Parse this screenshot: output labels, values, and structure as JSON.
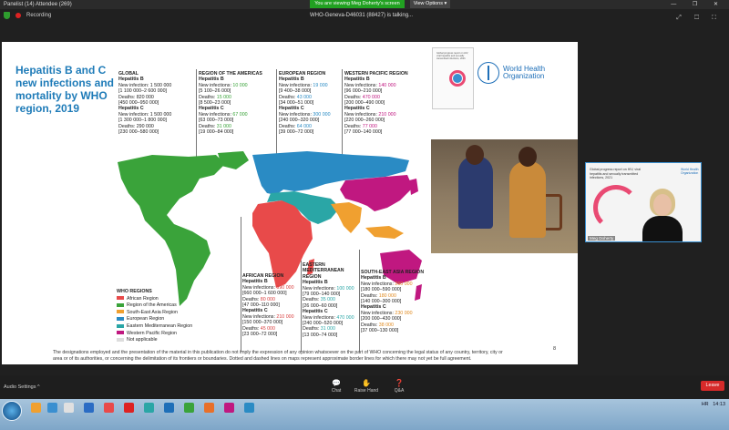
{
  "window": {
    "title": "Panelist (14) Attendee (269)",
    "banner": "You are viewing Meg Doherty's screen",
    "view_options": "View Options",
    "view_options_chevron": "▾",
    "recording": "Recording",
    "talking": "WHO-Geneva-D46031 (88427) is talking...",
    "window_buttons": "— ❐ ✕"
  },
  "slide": {
    "title": "Hepatitis B and C new infections and mortality by WHO region, 2019",
    "regions": [
      {
        "name": "GLOBAL",
        "hepb_label": "Hepatitis B",
        "hepb_new": "New infection: 1 500 000",
        "hepb_new_ci": "[1 100 000–2 600 000]",
        "hepb_deaths": "Deaths: 820 000",
        "hepb_deaths_ci": "[450 000–950 000]",
        "hepc_label": "Hepatitis C",
        "hepc_new": "New infection: 1 500 000",
        "hepc_new_ci": "[1 300 000–1 800 000]",
        "hepc_deaths": "Deaths: 290 000",
        "hepc_deaths_ci": "[230 000–580 000]"
      },
      {
        "name": "REGION OF THE AMERICAS",
        "hepb_label": "Hepatitis B",
        "hepb_new_label": "New infections:",
        "hepb_new_val": "10 000",
        "hepb_new_ci": "[5 100–26 000]",
        "hepb_deaths_label": "Deaths:",
        "hepb_deaths_val": "15 000",
        "hepb_deaths_ci": "[8 500–23 000]",
        "hepc_label": "Hepatitis C",
        "hepc_new_label": "New infections:",
        "hepc_new_val": "67 000",
        "hepc_new_ci": "[63 000–73 000]",
        "hepc_deaths_label": "Deaths:",
        "hepc_deaths_val": "31 000",
        "hepc_deaths_ci": "[19 000–84 000]"
      },
      {
        "name": "EUROPEAN REGION",
        "hepb_label": "Hepatitis B",
        "hepb_new_label": "New infections:",
        "hepb_new_val": "19 000",
        "hepb_new_ci": "[9 400–38 000]",
        "hepb_deaths_label": "Deaths:",
        "hepb_deaths_val": "43 000",
        "hepb_deaths_ci": "[34 000–51 000]",
        "hepc_label": "Hepatitis C",
        "hepc_new_label": "New infections:",
        "hepc_new_val": "300 000",
        "hepc_new_ci": "[240 000–320 000]",
        "hepc_deaths_label": "Deaths:",
        "hepc_deaths_val": "64 000",
        "hepc_deaths_ci": "[39 000–72 000]"
      },
      {
        "name": "WESTERN PACIFIC REGION",
        "hepb_label": "Hepatitis B",
        "hepb_new_label": "New infections:",
        "hepb_new_val": "140 000",
        "hepb_new_ci": "[96 000–210 000]",
        "hepb_deaths_label": "Deaths:",
        "hepb_deaths_val": "470 000",
        "hepb_deaths_ci": "[200 000–490 000]",
        "hepc_label": "Hepatitis C",
        "hepc_new_label": "New infections:",
        "hepc_new_val": "210 000",
        "hepc_new_ci": "[220 000–260 000]",
        "hepc_deaths_label": "Deaths:",
        "hepc_deaths_val": "77 000",
        "hepc_deaths_ci": "[77 000–140 000]"
      },
      {
        "name": "AFRICAN REGION",
        "hepb_label": "Hepatitis B",
        "hepb_new_label": "New infections:",
        "hepb_new_val": "990 000",
        "hepb_new_ci": "[660 000–1 600 000]",
        "hepb_deaths_label": "Deaths:",
        "hepb_deaths_val": "80 000",
        "hepb_deaths_ci": "[47 000–110 000]",
        "hepc_label": "Hepatitis C",
        "hepc_new_label": "New infections:",
        "hepc_new_val": "210 000",
        "hepc_new_ci": "[150 000–370 000]",
        "hepc_deaths_label": "Deaths:",
        "hepc_deaths_val": "45 000",
        "hepc_deaths_ci": "[23 000–72 000]"
      },
      {
        "name": "EASTERN MEDITERRANEAN REGION",
        "hepb_label": "Hepatitis B",
        "hepb_new_label": "New infections:",
        "hepb_new_val": "100 000",
        "hepb_new_ci": "[79 000–140 000]",
        "hepb_deaths_label": "Deaths:",
        "hepb_deaths_val": "35 000",
        "hepb_deaths_ci": "[26 000–60 000]",
        "hepc_label": "Hepatitis C",
        "hepc_new_label": "New infections:",
        "hepc_new_val": "470 000",
        "hepc_new_ci": "[240 000–520 000]",
        "hepc_deaths_label": "Deaths:",
        "hepc_deaths_val": "31 000",
        "hepc_deaths_ci": "[13 000–74 000]"
      },
      {
        "name": "SOUTH-EAST ASIA REGION",
        "hepb_label": "Hepatitis B",
        "hepb_new_label": "New infections:",
        "hepb_new_val": "260 000",
        "hepb_new_ci": "[180 000–590 000]",
        "hepb_deaths_label": "Deaths:",
        "hepb_deaths_val": "180 000",
        "hepb_deaths_ci": "[140 000–300 000]",
        "hepc_label": "Hepatitis C",
        "hepc_new_label": "New infections:",
        "hepc_new_val": "230 000",
        "hepc_new_ci": "[200 000–430 000]",
        "hepc_deaths_label": "Deaths:",
        "hepc_deaths_val": "38 000",
        "hepc_deaths_ci": "[37 000–130 000]"
      }
    ],
    "legend": {
      "title": "WHO REGIONS",
      "items": [
        {
          "label": "African Region",
          "color": "#e84a4a"
        },
        {
          "label": "Region of the Americas",
          "color": "#3aa33a"
        },
        {
          "label": "South-East Asia Region",
          "color": "#f0a030"
        },
        {
          "label": "European Region",
          "color": "#2a8bc4"
        },
        {
          "label": "Eastern Mediterranean Region",
          "color": "#2aa6a6"
        },
        {
          "label": "Western Pacific Region",
          "color": "#c01880"
        },
        {
          "label": "Not applicable",
          "color": "#dddddd"
        }
      ]
    },
    "disclaimer": "The designations employed and the presentation of the material in this publication do not imply the expression of any opinion whatsoever on the part of WHO concerning the legal status of any country, territory, city or area or of its authorities, or concerning the delimitation of its frontiers or boundaries. Dotted and dashed lines on maps represent approximate border lines for which there may not yet be full agreement.",
    "page_number": "8",
    "who_logo_line1": "World Health",
    "who_logo_line2": "Organization",
    "cover_text": "Global progress report on HIV, viral hepatitis and sexually transmitted infections, 2021"
  },
  "webcam": {
    "slide_text": "Global progress report on HIV, viral hepatitis and sexually transmitted infections, 2021",
    "who_line1": "World Health",
    "who_line2": "Organization",
    "name": "Meg Doherty"
  },
  "bottom": {
    "audio_settings": "Audio Settings",
    "audio_chevron": "^",
    "chat": "Chat",
    "chat_icon": "💬",
    "raise_hand": "Raise Hand",
    "raise_hand_icon": "✋",
    "qa": "Q&A",
    "qa_icon": "❓",
    "leave": "Leave"
  },
  "taskbar": {
    "lang": "HR",
    "time": "14:13",
    "icons": [
      "#f0a030",
      "#3a8fd0",
      "#e0e0e0",
      "#2a6cc4",
      "#e84a4a",
      "#d22",
      "#2aa6a6",
      "#1e6fb8",
      "#3aa33a",
      "#e8702a",
      "#c01880",
      "#2a8bc4"
    ]
  },
  "colors": {
    "americas": "#3aa33a",
    "african": "#e84a4a",
    "european": "#2a8bc4",
    "emr": "#2aa6a6",
    "wpr": "#c01880",
    "searo": "#f0a030"
  }
}
